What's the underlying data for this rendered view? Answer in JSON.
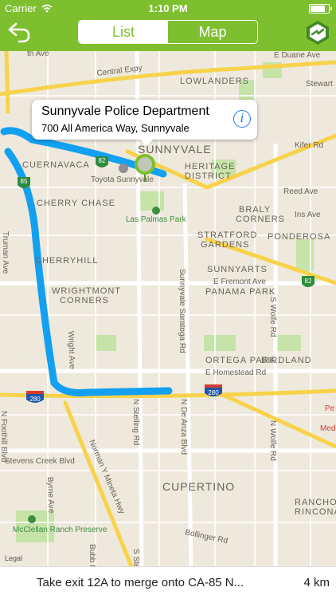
{
  "status_bar": {
    "carrier": "Carrier",
    "time": "1:10 PM",
    "wifi_icon": "wifi-icon",
    "battery_level": 0.9
  },
  "nav": {
    "back_icon": "back-arrow-icon",
    "tabs": [
      {
        "label": "List",
        "active": true
      },
      {
        "label": "Map",
        "active": false
      }
    ],
    "logo_icon": "police-badge-icon",
    "accent_color": "#7ebf2f"
  },
  "map": {
    "neighborhoods": [
      "LOWLANDERS",
      "SUNNYVALE",
      "HERITAGE",
      "DISTRICT",
      "CUERNAVACA",
      "CHERRY CHASE",
      "CHERRYHILL",
      "WRIGHTMONT",
      "CORNERS",
      "BRALY",
      "CORNERS",
      "PONDEROSA",
      "STRATFORD",
      "GARDENS",
      "SUNNYARTS",
      "PANAMA PARK",
      "ORTEGA PARK",
      "BIRDLAND",
      "CUPERTINO",
      "RANCHO",
      "RINCONA"
    ],
    "streets": [
      "Central Expy",
      "E Duane Ave",
      "Stewart",
      "Kifer Rd",
      "Reed Ave",
      "Ins Ave",
      "E Fremont Ave",
      "E Homestead Rd",
      "Stevens Creek Blvd",
      "Bollinger Rd",
      "Wright Ave",
      "Truman Ave",
      "S Wolfe Rd",
      "N Wolfe Rd",
      "Sunnyvale Saratoga Rd",
      "N Stelling Rd",
      "N De Anza Blvd",
      "Byrne Ave",
      "Norman Y Mineta Hwy",
      "N Foothill Blvd",
      "S Stelling Rd",
      "Bubb Rd",
      "Toyota Sunnyvale",
      "Las Palmas Park",
      "McClellan Ranch Preserve",
      "Medi",
      "Pe"
    ],
    "street_prefix": "th Ave",
    "highway_shields": [
      "82",
      "85",
      "82",
      "280",
      "280"
    ],
    "legal": "Legal",
    "route_color": "#14a0f0",
    "pin_color": "#7ebf2f"
  },
  "callout": {
    "title": "Sunnyvale Police Department",
    "address": "700 All America Way, Sunnyvale",
    "info_icon": "info-icon"
  },
  "directions": {
    "instruction": "Take exit 12A to merge onto CA-85 N...",
    "distance": "4 km"
  }
}
